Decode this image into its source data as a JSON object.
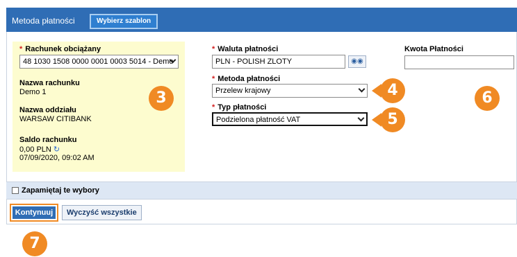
{
  "header": {
    "title": "Metoda płatności",
    "template_button": "Wybierz szablon"
  },
  "account": {
    "debit_label": "Rachunek obciążany",
    "debit_value": "48 1030 1508 0000 0001 0003 5014 - Demo",
    "name_label": "Nazwa rachunku",
    "name_value": "Demo 1",
    "branch_label": "Nazwa oddziału",
    "branch_value": "WARSAW CITIBANK",
    "balance_label": "Saldo rachunku",
    "balance_value": "0,00 PLN",
    "balance_date": "07/09/2020, 09:02 AM"
  },
  "payment": {
    "currency_label": "Waluta płatności",
    "currency_value": "PLN - POLISH ZLOTY",
    "method_label": "Metoda płatności",
    "method_value": "Przelew krajowy",
    "type_label": "Typ płatności",
    "type_value": "Podzielona płatność VAT",
    "amount_label": "Kwota Płatności",
    "amount_value": ""
  },
  "remember": {
    "label": "Zapamiętaj te wybory",
    "checked": false
  },
  "actions": {
    "continue": "Kontynuuj",
    "clear": "Wyczyść wszystkie"
  },
  "callouts": {
    "c3": "3",
    "c4": "4",
    "c5": "5",
    "c6": "6",
    "c7": "7"
  },
  "colors": {
    "header_bg": "#2f6db5",
    "highlight": "#f08a24",
    "account_panel_bg": "#fdfccf",
    "remember_bar_bg": "#dde7f4"
  }
}
